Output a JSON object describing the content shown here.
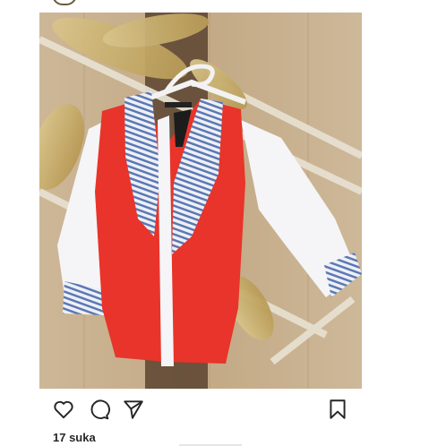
{
  "post": {
    "image": {
      "alt_subject": "clothing-photo",
      "background_color": "#c7b08f",
      "garment_colors": {
        "vest": "#e8342a",
        "sleeves": "#f5f5f7",
        "stripe": "#5b78b4"
      }
    },
    "actions": {
      "like_icon": "heart-icon",
      "comment_icon": "comment-icon",
      "share_icon": "send-icon",
      "save_icon": "bookmark-icon"
    },
    "likes_text": "17 suka"
  }
}
